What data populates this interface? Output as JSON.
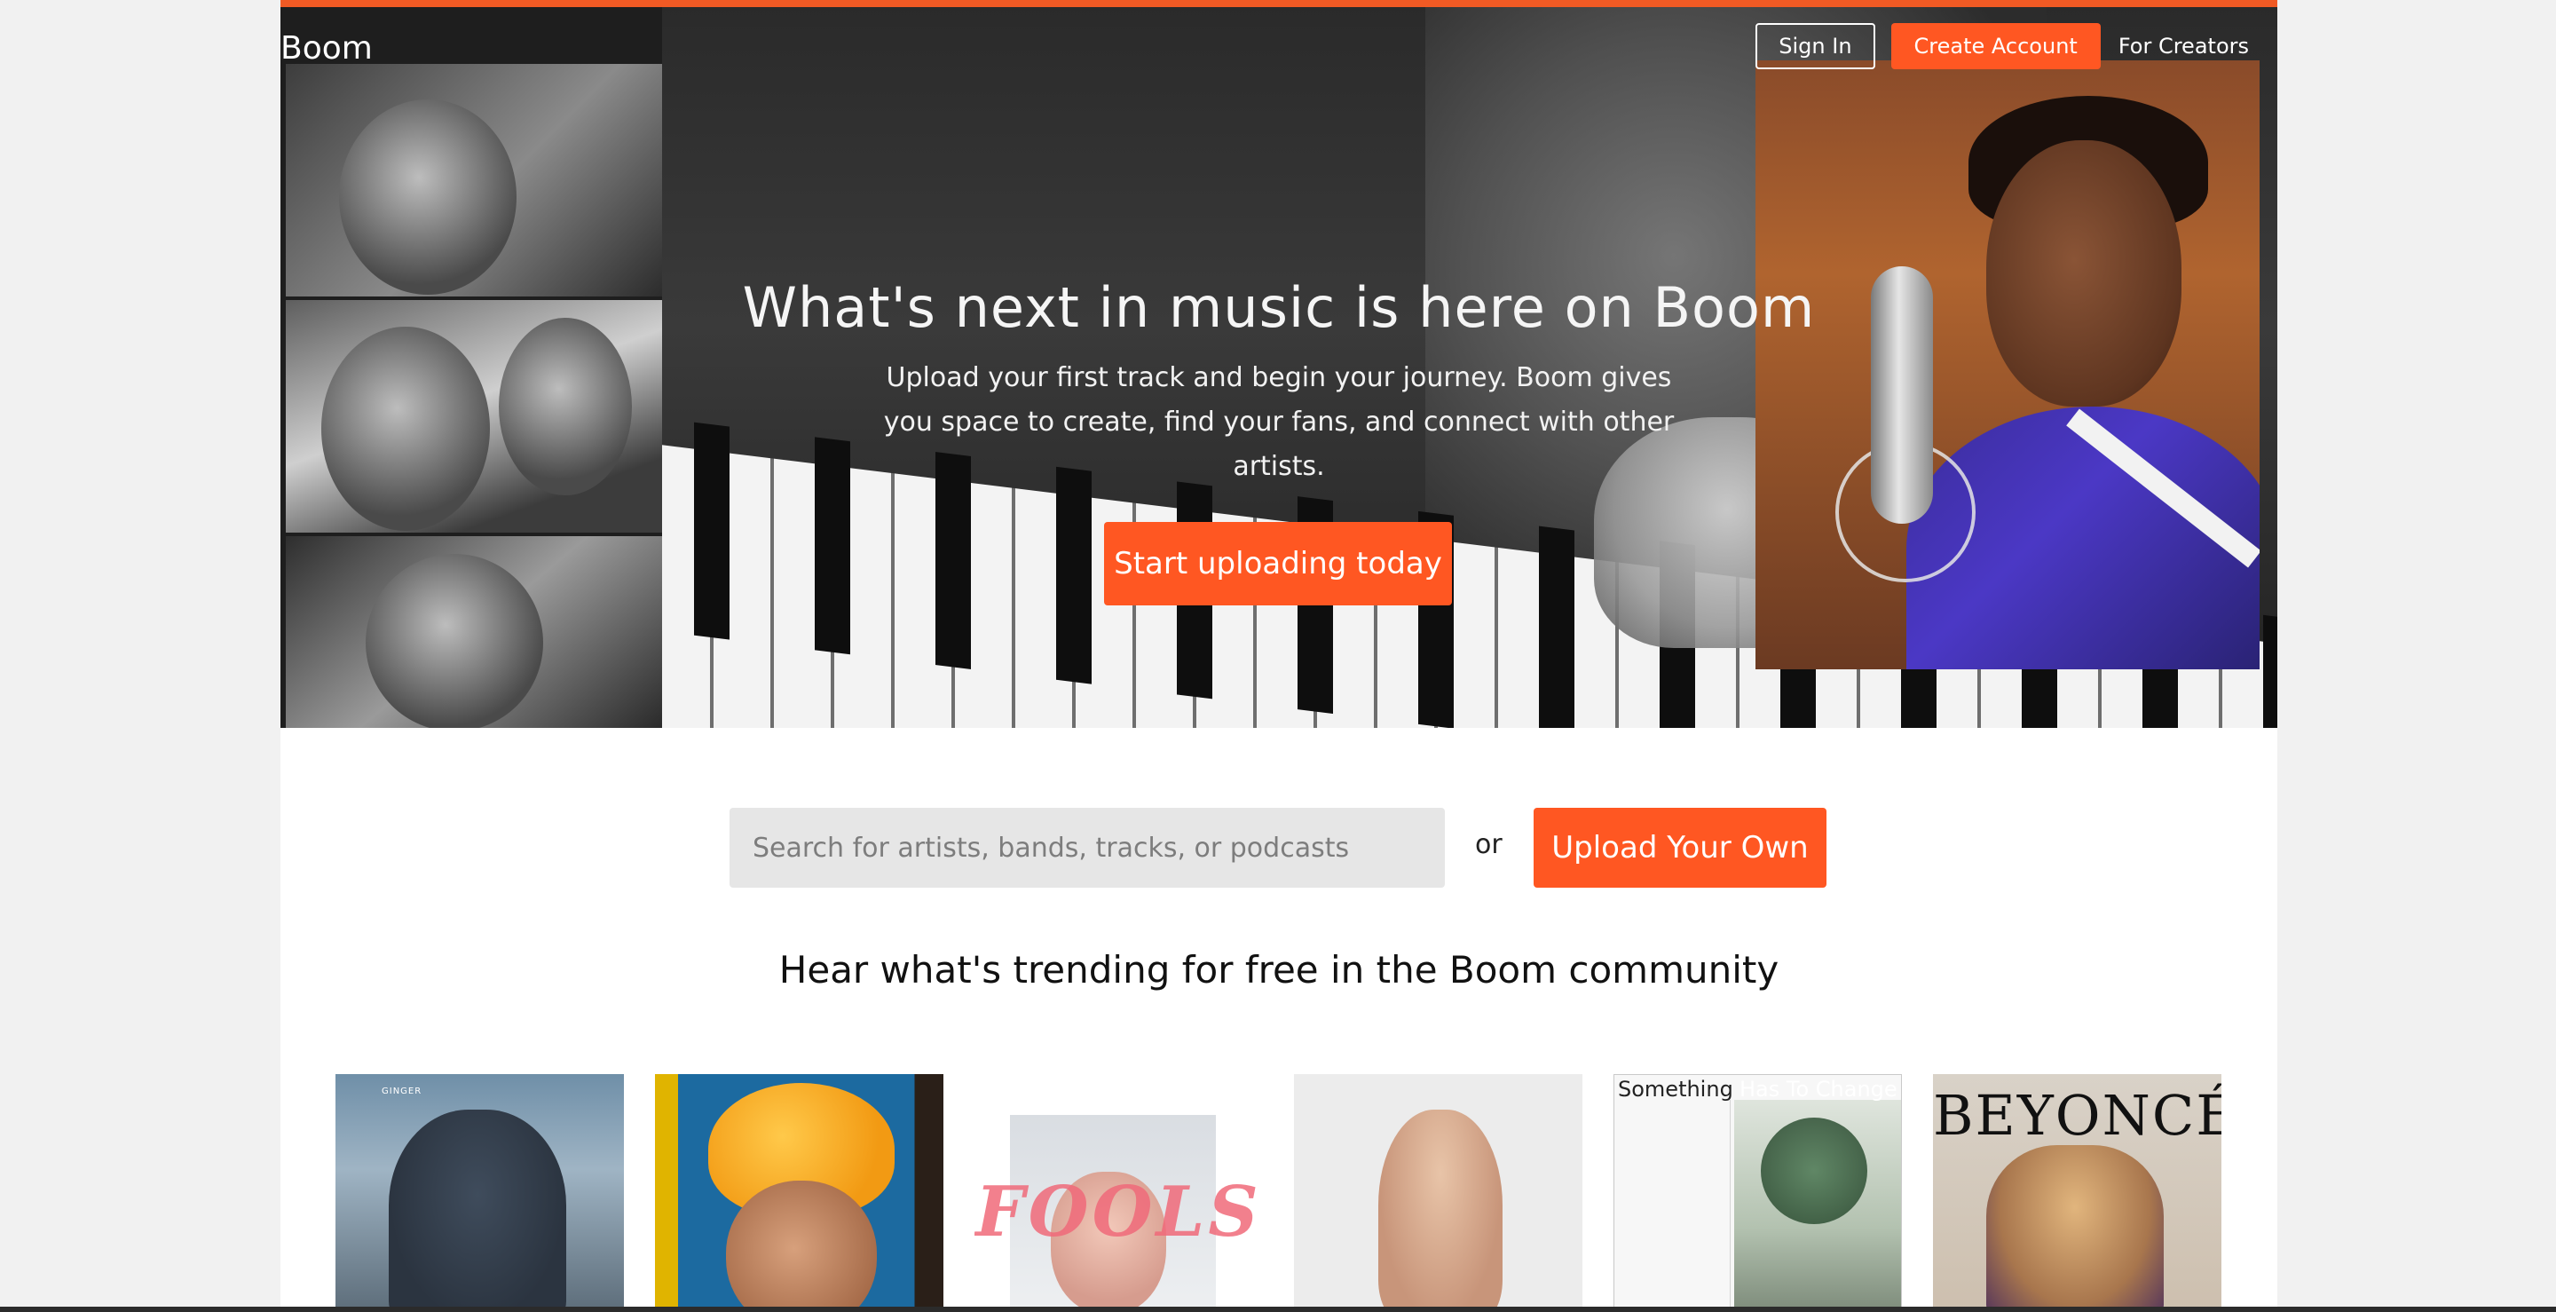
{
  "header": {
    "logo": "Boom",
    "sign_in": "Sign In",
    "create_account": "Create Account",
    "for_creators": "For Creators"
  },
  "hero": {
    "title": "What's next in music is here on Boom",
    "subtitle": "Upload your first track and begin your journey. Boom gives you space to create, find your fans, and connect with other artists.",
    "cta": "Start uploading today"
  },
  "search": {
    "placeholder": "Search for artists, bands, tracks, or podcasts",
    "value": "",
    "or": "or",
    "upload_label": "Upload Your Own"
  },
  "trending": {
    "heading": "Hear what's trending for free in the Boom community",
    "albums": [
      {
        "text": "GINGER"
      },
      {
        "text": ""
      },
      {
        "text": "FOOLS"
      },
      {
        "text": ""
      },
      {
        "text_left": "Something",
        "text_right": "Has To Change"
      },
      {
        "text": "BEYONCÉ"
      }
    ]
  },
  "colors": {
    "accent": "#ff5722",
    "strip": "#f15a24",
    "search_bg": "#e6e6e6"
  }
}
